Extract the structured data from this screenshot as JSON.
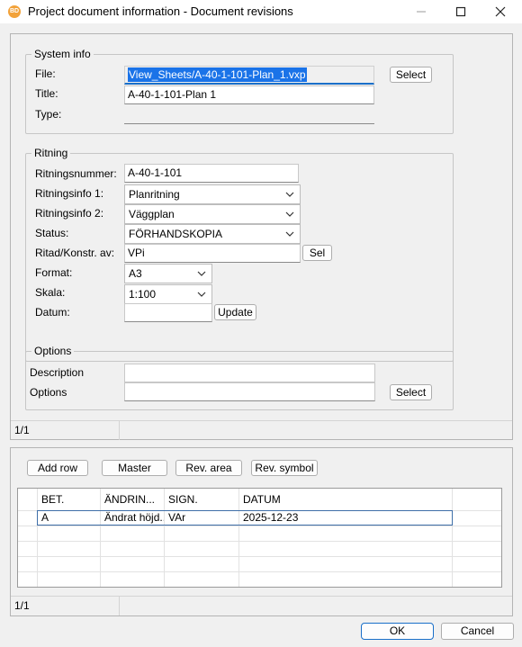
{
  "window": {
    "app_icon_text": "BD",
    "title": "Project document information - Document revisions"
  },
  "system_info": {
    "group_label": "System info",
    "file_label": "File:",
    "file_value": "View_Sheets/A-40-1-101-Plan_1.vxp",
    "title_label": "Title:",
    "title_value": "A-40-1-101-Plan 1",
    "type_label": "Type:",
    "type_value": "",
    "select_button": "Select"
  },
  "ritning": {
    "group_label": "Ritning",
    "ritningsnummer_label": "Ritningsnummer:",
    "ritningsnummer_value": "A-40-1-101",
    "info1_label": "Ritningsinfo 1:",
    "info1_value": "Planritning",
    "info2_label": "Ritningsinfo 2:",
    "info2_value": "Väggplan",
    "status_label": "Status:",
    "status_value": "FÖRHANDSKOPIA",
    "ritad_label": "Ritad/Konstr. av:",
    "ritad_value": "VPi",
    "sel_button": "Sel",
    "format_label": "Format:",
    "format_value": "A3",
    "skala_label": "Skala:",
    "skala_value": "1:100",
    "datum_label": "Datum:",
    "datum_value": "",
    "update_button": "Update"
  },
  "options": {
    "group_label": "Options",
    "description_label": "Description",
    "description_value": "",
    "options_label": "Options",
    "options_value": "",
    "select_button": "Select"
  },
  "top_status": {
    "page": "1/1"
  },
  "revisions": {
    "add_row_button": "Add row",
    "master_button": "Master",
    "rev_area_button": "Rev. area",
    "rev_symbol_button": "Rev. symbol",
    "columns": [
      "BET.",
      "ÄNDRIN...",
      "SIGN.",
      "DATUM"
    ],
    "rows": [
      [
        "A",
        "Ändrat höjd...",
        "VAr",
        "2025-12-23"
      ]
    ]
  },
  "bottom_status": {
    "page": "1/1"
  },
  "footer": {
    "ok_button": "OK",
    "cancel_button": "Cancel"
  }
}
